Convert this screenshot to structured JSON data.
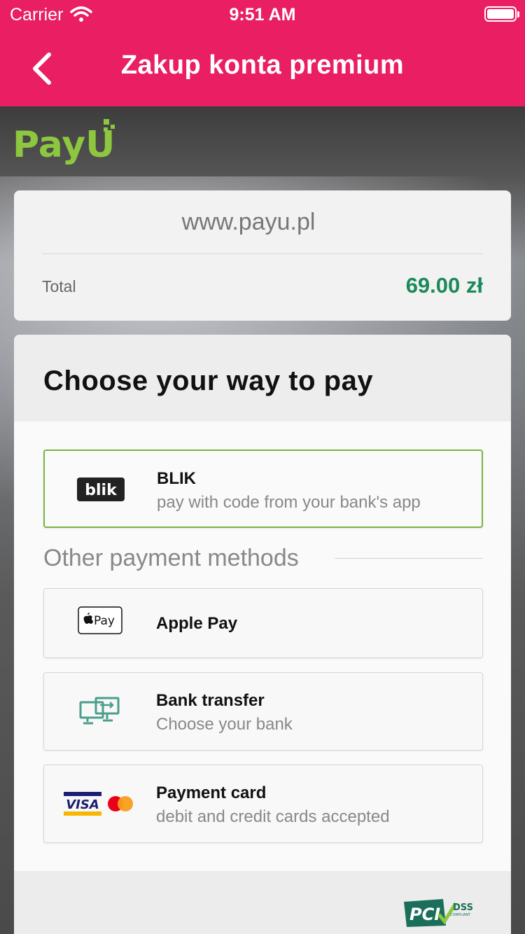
{
  "status_bar": {
    "carrier": "Carrier",
    "time": "9:51 AM"
  },
  "nav": {
    "title": "Zakup konta premium",
    "back_icon": "chevron-left-icon"
  },
  "brand": {
    "logo_text": "PayU",
    "color": "#8dc63f"
  },
  "summary": {
    "merchant": "www.payu.pl",
    "total_label": "Total",
    "total_value": "69.00 zł",
    "total_color": "#1b8a5a"
  },
  "payment": {
    "heading": "Choose your way to pay",
    "featured": {
      "title": "BLIK",
      "subtitle": "pay with code from your bank's app",
      "icon": "blik-logo",
      "logo_text": "blik"
    },
    "other_label": "Other payment methods",
    "methods": [
      {
        "title": "Apple Pay",
        "subtitle": "",
        "icon": "apple-pay-logo",
        "logo_text": "Pay"
      },
      {
        "title": "Bank transfer",
        "subtitle": "Choose your bank",
        "icon": "bank-transfer-icon"
      },
      {
        "title": "Payment card",
        "subtitle": "debit and credit cards accepted",
        "icon": "visa-mastercard-logos",
        "logo_text": "VISA"
      }
    ]
  },
  "footer": {
    "badge_text": "PCI",
    "badge_sub": "DSS",
    "badge_sub2": "COMPLIANT"
  },
  "colors": {
    "accent": "#e91e63",
    "selected_border": "#7cb342"
  }
}
